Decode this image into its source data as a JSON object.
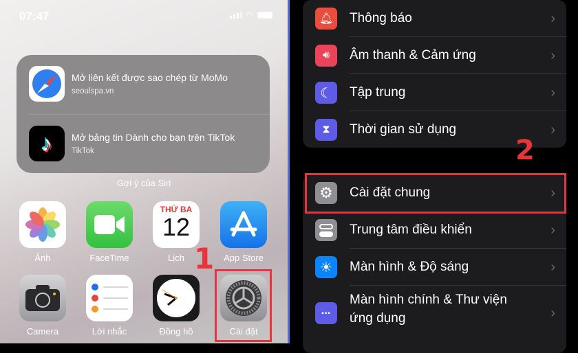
{
  "home": {
    "status": {
      "time": "07:47"
    },
    "siri": {
      "label": "Gợi ý của Siri",
      "suggestions": [
        {
          "title": "Mở liên kết được sao chép từ MoMo",
          "subtitle": "seoulspa.vn",
          "icon": "safari-icon"
        },
        {
          "title": "Mở bảng tin Dành cho bạn trên TikTok",
          "subtitle": "TikTok",
          "icon": "tiktok-icon"
        }
      ]
    },
    "apps": [
      {
        "label": "Ảnh",
        "icon": "photos-icon"
      },
      {
        "label": "FaceTime",
        "icon": "facetime-icon"
      },
      {
        "label": "Lịch",
        "icon": "calendar-icon",
        "day": "THỨ BA",
        "date": "12"
      },
      {
        "label": "App Store",
        "icon": "appstore-icon"
      },
      {
        "label": "Camera",
        "icon": "camera-icon"
      },
      {
        "label": "Lời nhắc",
        "icon": "reminders-icon"
      },
      {
        "label": "Đồng hồ",
        "icon": "clock-icon"
      },
      {
        "label": "Cài đặt",
        "icon": "settings-icon"
      }
    ],
    "step": "1"
  },
  "settings": {
    "group1": [
      {
        "label": "Thông báo",
        "icon": "bell-icon",
        "color": "#eb4d3d"
      },
      {
        "label": "Âm thanh & Cảm ứng",
        "icon": "speaker-icon",
        "color": "#eb445a"
      },
      {
        "label": "Tập trung",
        "icon": "moon-icon",
        "color": "#5e5ce6"
      },
      {
        "label": "Thời gian sử dụng",
        "icon": "hourglass-icon",
        "color": "#5e5ce6"
      }
    ],
    "group2": [
      {
        "label": "Cài đặt chung",
        "icon": "gear-icon",
        "color": "#8e8e93"
      },
      {
        "label": "Trung tâm điều khiển",
        "icon": "toggles-icon",
        "color": "#8e8e93"
      },
      {
        "label": "Màn hình & Độ sáng",
        "icon": "sun-icon",
        "color": "#0a84ff"
      },
      {
        "label": "Màn hình chính & Thư viện ứng dụng",
        "icon": "grid-icon",
        "color": "#5e5ce6"
      }
    ],
    "step": "2",
    "highlight_color": "#e8343a"
  }
}
